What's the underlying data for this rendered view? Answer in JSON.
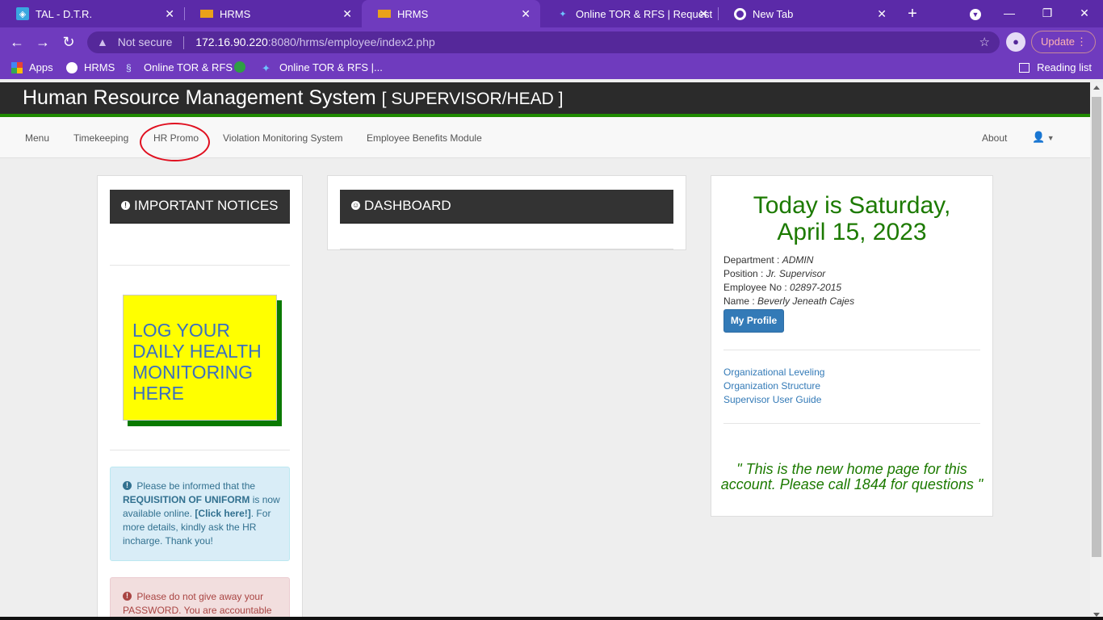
{
  "browser": {
    "tabs": [
      {
        "title": "TAL - D.T.R.",
        "icon": "tal-favicon-icon"
      },
      {
        "title": "HRMS",
        "icon": "hrms-favicon-icon"
      },
      {
        "title": "HRMS",
        "icon": "hrms-favicon-icon",
        "active": true
      },
      {
        "title": "Online TOR & RFS | Request",
        "icon": "tor-favicon-icon"
      },
      {
        "title": "New Tab",
        "icon": "chrome-icon"
      }
    ],
    "address": {
      "security_label": "Not secure",
      "host": "172.16.90.220",
      "path": ":8080/hrms/employee/index2.php"
    },
    "update_label": "Update",
    "bookmarks": [
      {
        "label": "Apps",
        "icon": "apps-grid-icon"
      },
      {
        "label": "HRMS",
        "icon": "globe-icon"
      },
      {
        "label": "Online TOR & RFS",
        "icon": "tor-favicon-icon"
      },
      {
        "label": "",
        "icon": "green-globe-icon"
      },
      {
        "label": "Online TOR & RFS |...",
        "icon": "tor-favicon-icon"
      }
    ],
    "reading_list_label": "Reading list",
    "accent_color": "#6f3bbe"
  },
  "header": {
    "title": "Human Resource Management System",
    "role": "[ SUPERVISOR/HEAD ]"
  },
  "nav": {
    "items": [
      "Menu",
      "Timekeeping",
      "HR Promo",
      "Violation Monitoring System",
      "Employee Benefits Module"
    ],
    "about": "About",
    "highlighted_item": "HR Promo"
  },
  "notices": {
    "title": "IMPORTANT NOTICES",
    "health_banner": "LOG YOUR DAILY HEALTH MONITORING HERE",
    "info_text_1": "Please be informed that the",
    "info_bold": "REQUISITION OF UNIFORM",
    "info_text_2": "is now available online.",
    "info_link": "[Click here!]",
    "info_text_3": ". For more details, kindly ask the HR incharge. Thank you!",
    "danger_text": "Please do not give away your PASSWORD. You are accountable"
  },
  "dashboard": {
    "title": "DASHBOARD"
  },
  "profile": {
    "today_line1": "Today is Saturday,",
    "today_line2": "April 15, 2023",
    "department_label": "Department :",
    "department": "ADMIN",
    "position_label": "Position :",
    "position": "Jr. Supervisor",
    "employee_no_label": "Employee No :",
    "employee_no": "02897-2015",
    "name_label": "Name :",
    "name": "Beverly Jeneath Cajes",
    "button": "My Profile",
    "links": [
      "Organizational Leveling",
      "Organization Structure",
      "Supervisor User Guide"
    ],
    "quote": "\" This is the new home page for this account. Please call 1844 for questions \""
  }
}
